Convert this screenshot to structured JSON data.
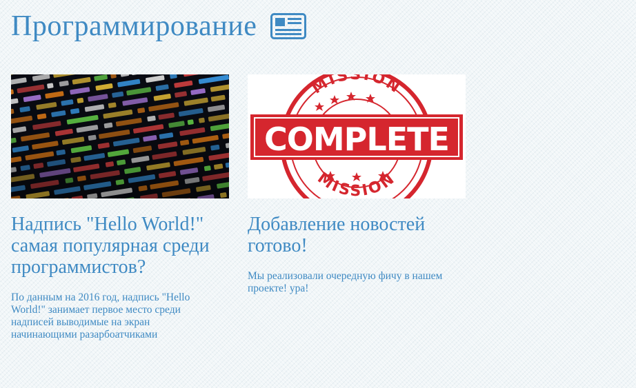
{
  "header": {
    "title": "Программирование",
    "icon": "newspaper-icon"
  },
  "colors": {
    "accent": "#3f8ac3",
    "background": "#f1f6f8",
    "stamp_red": "#d5262e"
  },
  "articles": [
    {
      "image": "code-screen-image",
      "title": "Надпись \"Hello World!\" самая популярная среди программистов?",
      "text": "По данным на 2016 год, надпись \"Hello World!\" занимает первое место среди надписей выводимые на экран начинающими разарбоатчиками"
    },
    {
      "image": "mission-complete-stamp-image",
      "title": "Добавление новостей готово!",
      "text": "Мы реализовали очередную фичу в нашем проекте! ура!",
      "stamp_word": "COMPLETE",
      "stamp_ring_top": "MISSION",
      "stamp_ring_bottom": "MISSION"
    }
  ]
}
